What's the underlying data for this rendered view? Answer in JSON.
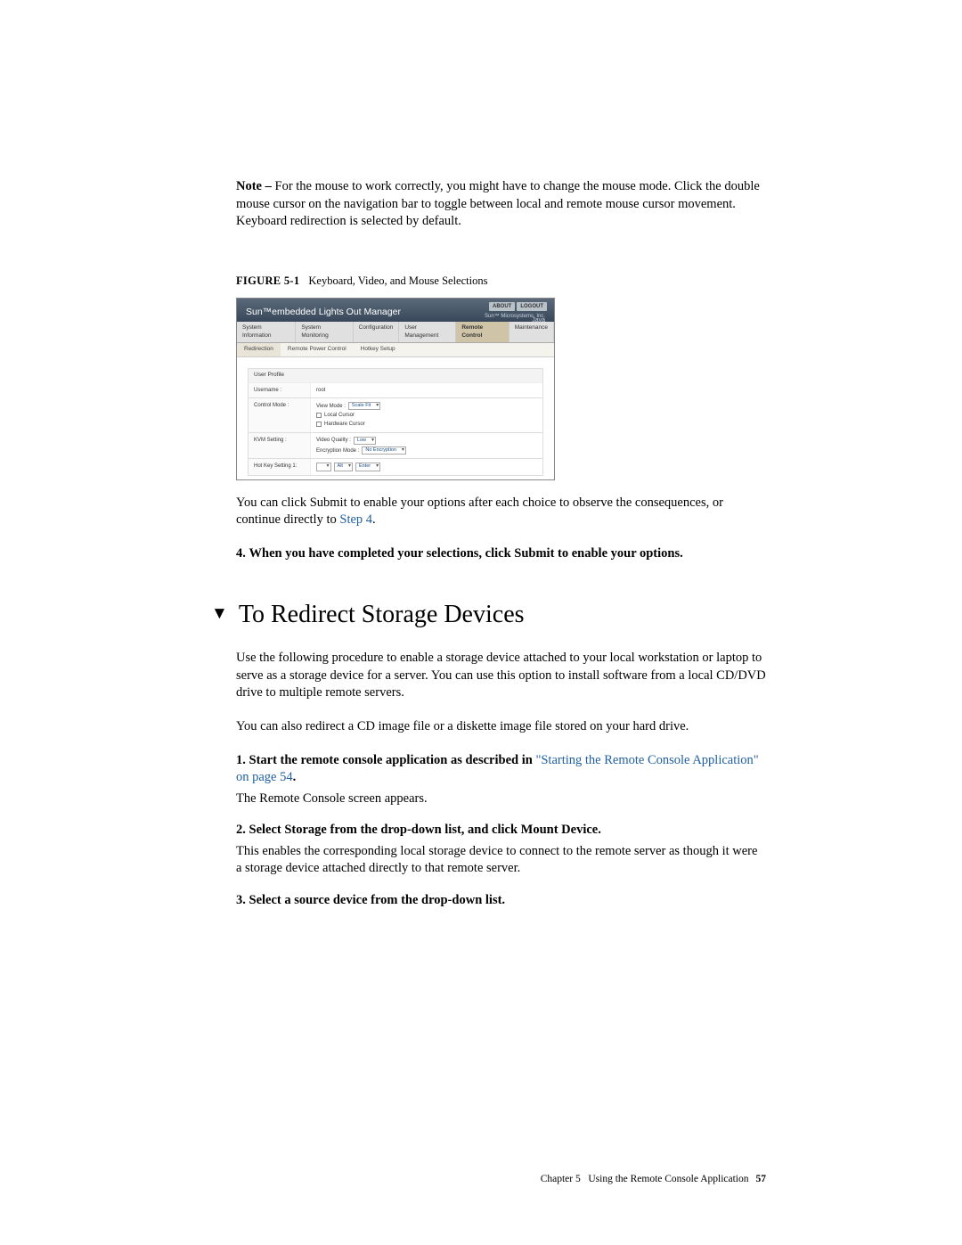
{
  "note": {
    "label": "Note –",
    "text": " For the mouse to work correctly, you might have to change the mouse mode. Click the double mouse cursor on the navigation bar to toggle between local and remote mouse cursor movement. Keyboard redirection is selected by default."
  },
  "figure": {
    "label": "FIGURE 5-1",
    "title": "Keyboard, Video, and Mouse Selections"
  },
  "screenshot": {
    "title": "Sun™embedded Lights Out Manager",
    "topButtons": [
      "ABOUT",
      "LOGOUT"
    ],
    "logo": "Java",
    "subhead": "Sun™ Microsystems, Inc.",
    "tabsTop": [
      "System Information",
      "System Monitoring",
      "Configuration",
      "User Management",
      "Remote Control",
      "Maintenance"
    ],
    "tabsTopActive": 4,
    "tabsSub": [
      "Redirection",
      "Remote Power Control",
      "Hotkey Setup"
    ],
    "tabsSubActive": 0,
    "profileHeader": "User Profile",
    "rows": {
      "username": {
        "label": "Username :",
        "value": "root"
      },
      "controlMode": {
        "label": "Control Mode :",
        "viewMode": "View Mode :",
        "viewModeVal": "Scale Fit",
        "local": "Local Cursor",
        "hardware": "Hardware Cursor"
      },
      "kvm": {
        "label": "KVM Setting :",
        "videoQuality": "Video Quality :",
        "videoQualityVal": "Low",
        "encryption": "Encryption Mode :",
        "encryptionVal": "No Encryption"
      },
      "hotkey": {
        "label": "Hot Key Setting 1:",
        "alt": "Alt",
        "enter": "Enter"
      }
    }
  },
  "afterFig": {
    "text": "You can click Submit to enable your options after each choice to observe the consequences, or continue directly to ",
    "link": "Step 4",
    "after": "."
  },
  "step4": {
    "num": "4.",
    "text": "When you have completed your selections, click Submit to enable your options."
  },
  "section": {
    "title": "To Redirect Storage Devices"
  },
  "intro1": "Use the following procedure to enable a storage device attached to your local workstation or laptop to serve as a storage device for a server. You can use this option to install software from a local CD/DVD drive to multiple remote servers.",
  "intro2": "You can also redirect a CD image file or a diskette image file stored on your hard drive.",
  "steps": {
    "s1": {
      "num": "1.",
      "bold": "Start the remote console application as described in ",
      "link": "\"Starting the Remote Console Application\" on page 54",
      "boldAfter": ".",
      "sub": "The Remote Console screen appears."
    },
    "s2": {
      "num": "2.",
      "bold": "Select Storage from the drop-down list, and click Mount Device.",
      "sub": "This enables the corresponding local storage device to connect to the remote server as though it were a storage device attached directly to that remote server."
    },
    "s3": {
      "num": "3.",
      "bold": "Select a source device from the drop-down list."
    }
  },
  "footer": {
    "chapter": "Chapter 5",
    "title": "Using the Remote Console Application",
    "page": "57"
  }
}
